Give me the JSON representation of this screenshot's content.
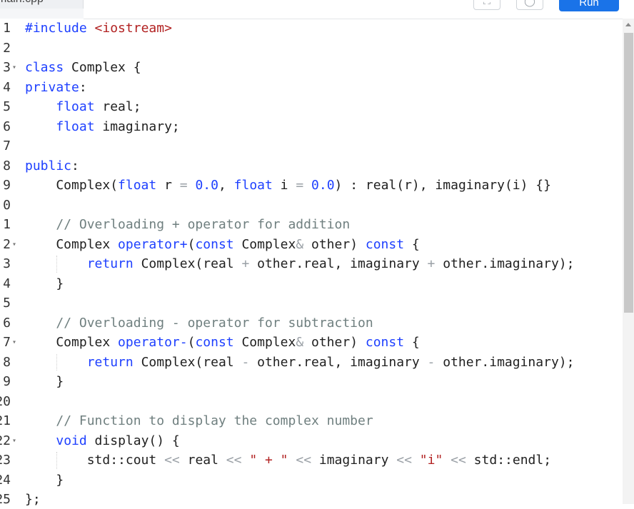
{
  "tab": {
    "title": "main.cpp"
  },
  "toolbar": {
    "run_label": "Run",
    "expand_glyph": "⛶",
    "settings_glyph": "◯"
  },
  "lines": [
    {
      "n": "1",
      "text": "#include <iostream>"
    },
    {
      "n": "2",
      "text": ""
    },
    {
      "n": "3",
      "text": "class Complex {",
      "fold": true
    },
    {
      "n": "4",
      "text": "private:"
    },
    {
      "n": "5",
      "text": "    float real;"
    },
    {
      "n": "6",
      "text": "    float imaginary;"
    },
    {
      "n": "7",
      "text": ""
    },
    {
      "n": "8",
      "text": "public:"
    },
    {
      "n": "9",
      "text": "    Complex(float r = 0.0, float i = 0.0) : real(r), imaginary(i) {}"
    },
    {
      "n": "0",
      "text": ""
    },
    {
      "n": "1",
      "text": "    // Overloading + operator for addition"
    },
    {
      "n": "2",
      "text": "    Complex operator+(const Complex& other) const {",
      "fold": true
    },
    {
      "n": "3",
      "text": "        return Complex(real + other.real, imaginary + other.imaginary);"
    },
    {
      "n": "4",
      "text": "    }"
    },
    {
      "n": "5",
      "text": ""
    },
    {
      "n": "6",
      "text": "    // Overloading - operator for subtraction"
    },
    {
      "n": "7",
      "text": "    Complex operator-(const Complex& other) const {",
      "fold": true
    },
    {
      "n": "8",
      "text": "        return Complex(real - other.real, imaginary - other.imaginary);"
    },
    {
      "n": "9",
      "text": "    }"
    },
    {
      "n": "20",
      "text": ""
    },
    {
      "n": "21",
      "text": "    // Function to display the complex number"
    },
    {
      "n": "22",
      "text": "    void display() {",
      "fold": true
    },
    {
      "n": "23",
      "text": "        std::cout << real << \" + \" << imaginary << \"i\" << std::endl;"
    },
    {
      "n": "24",
      "text": "    }"
    },
    {
      "n": "25",
      "text": "};"
    }
  ],
  "colors": {
    "keyword": "#1e40ff",
    "string": "#b22222",
    "comment": "#6f7f7f",
    "run_button": "#1a73e8"
  }
}
